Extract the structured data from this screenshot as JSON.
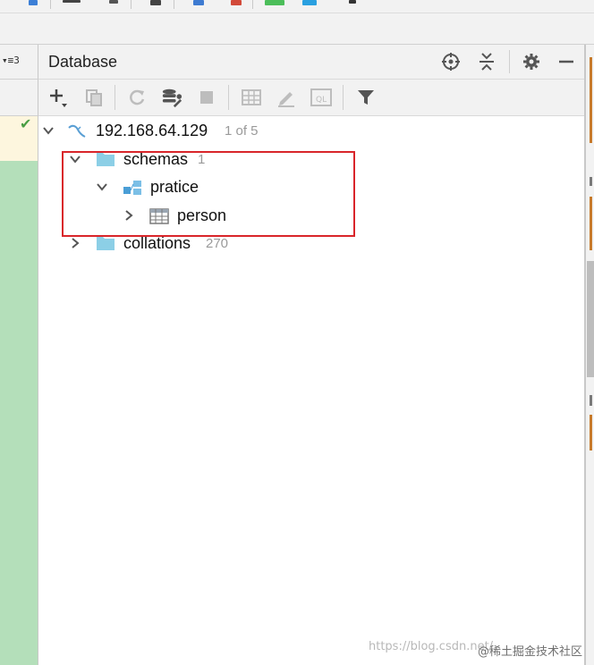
{
  "left_editor": {
    "structure_badge": "▾≡3"
  },
  "panel": {
    "title": "Database",
    "header_buttons": [
      "target-icon",
      "collapse-all-icon",
      "gear-icon",
      "minimize-icon"
    ],
    "toolbar_buttons": [
      "add-icon",
      "copy-icon",
      "refresh-icon",
      "data-source-properties-icon",
      "stop-icon",
      "table-view-icon",
      "edit-icon",
      "sql-console-icon",
      "filter-icon"
    ]
  },
  "tree": {
    "connection": {
      "label": "192.168.64.129",
      "meta": "1 of 5"
    },
    "schemas": {
      "label": "schemas",
      "meta": "1"
    },
    "schema_item": {
      "label": "pratice"
    },
    "table_item": {
      "label": "person"
    },
    "collations": {
      "label": "collations",
      "meta": "270"
    }
  },
  "colors": {
    "highlight": "#d9252a",
    "folder": "#8ccfe6",
    "added_lines": "#b4dfba"
  },
  "watermark": {
    "url": "https://blog.csdn.net/",
    "brand": "@稀土掘金技术社区"
  }
}
